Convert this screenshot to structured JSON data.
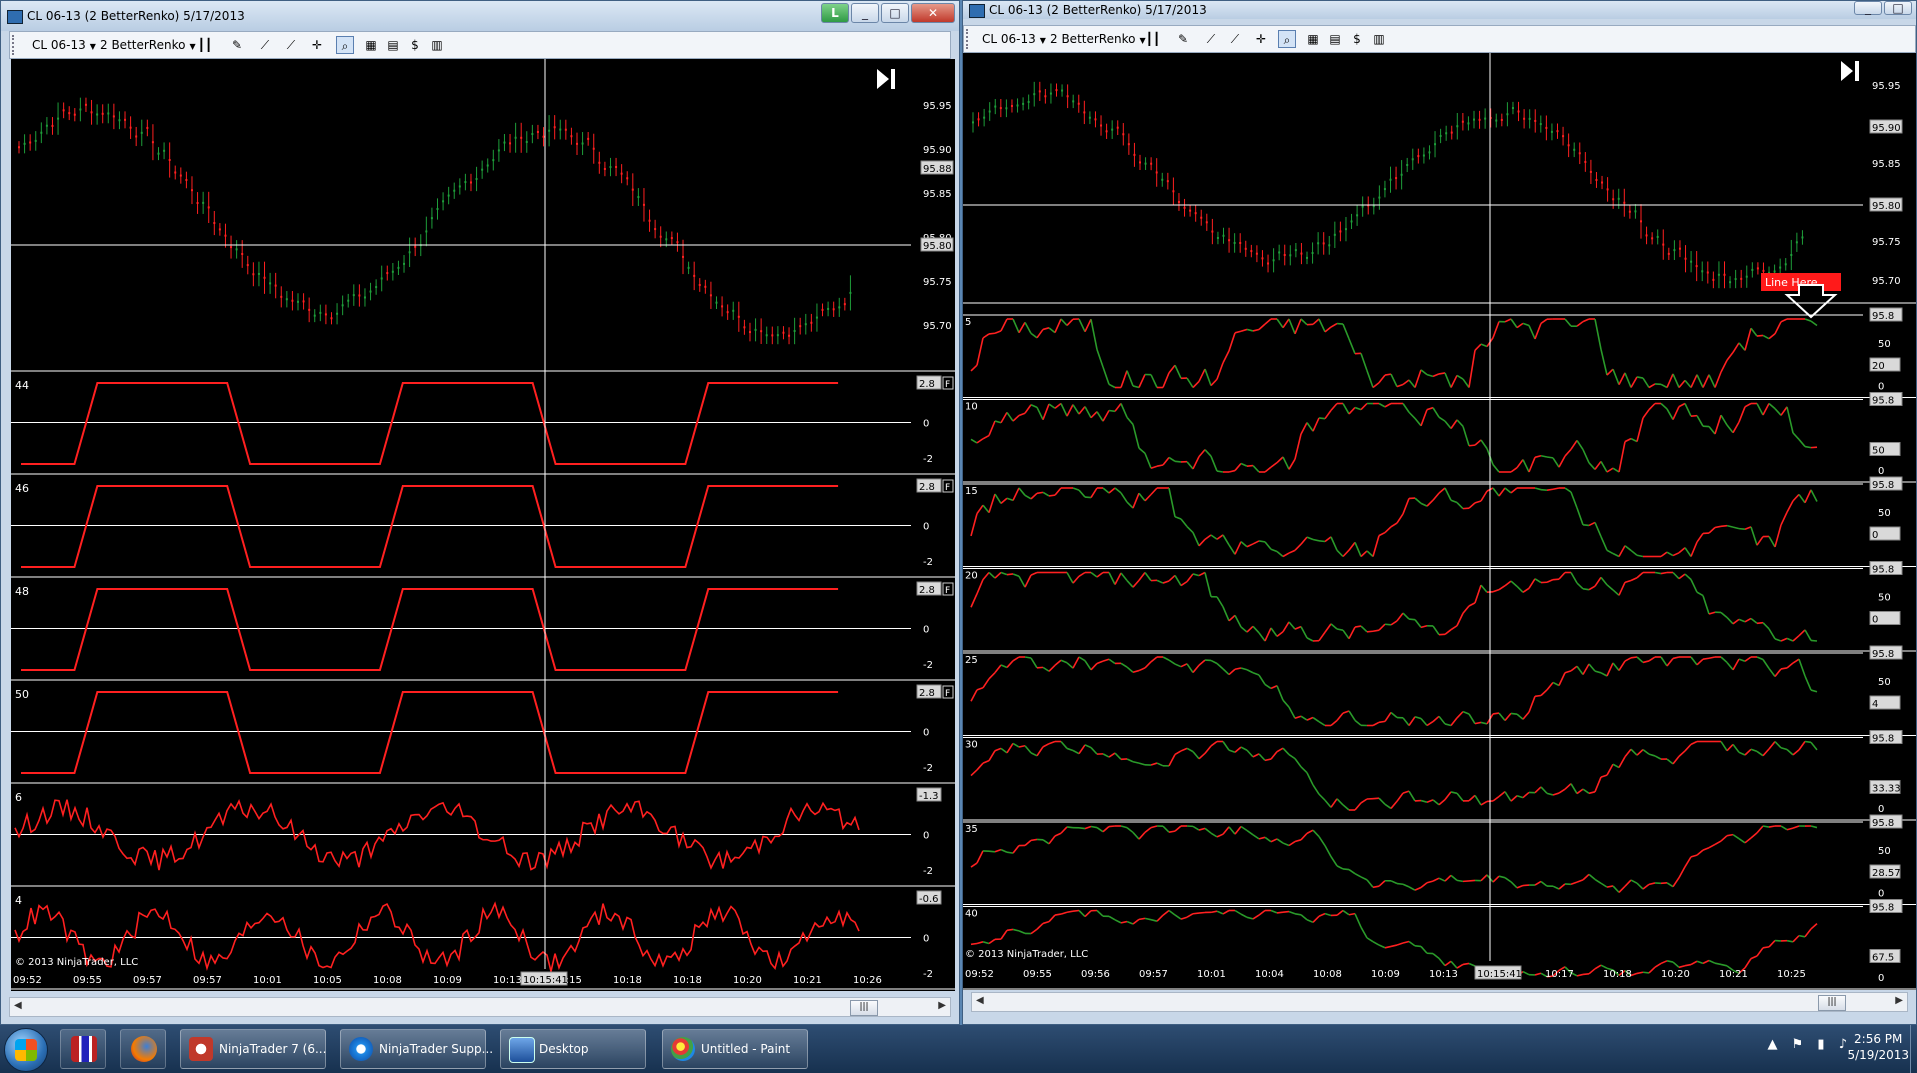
{
  "colors": {
    "up_bar": "#1e9e3a",
    "down_bar": "#ff2020",
    "osc_red": "#ff2020",
    "osc_green": "#2a9a2a",
    "chart_bg": "#000000",
    "grid": "#ffffff",
    "label_box": "#d9d9d9"
  },
  "windows": {
    "left": {
      "title": "CL 06-13 (2 BetterRenko)  5/17/2013",
      "instrument": "CL 06-13",
      "bar_type": "2 BetterRenko",
      "link_button": "L",
      "copyright": "© 2013 NinjaTrader, LLC",
      "crosshair_time": "10:15:41",
      "price_axis": [
        "95.95",
        "95.90",
        "95.85",
        "95.80",
        "95.75",
        "95.70"
      ],
      "current_price": "95.88",
      "crosshair_price": "95.80",
      "time_axis": [
        "09:52",
        "09:55",
        "09:57",
        "09:57",
        "10:01",
        "10:05",
        "10:08",
        "10:09",
        "10:13",
        "10:15",
        "10:18",
        "10:18",
        "10:20",
        "10:21",
        "10:26"
      ],
      "panels": [
        {
          "label": "44",
          "ticks": [
            "2",
            "0",
            "-2"
          ],
          "value": "2.8",
          "flag": "F"
        },
        {
          "label": "46",
          "ticks": [
            "2",
            "0",
            "-2"
          ],
          "value": "2.8",
          "flag": "F"
        },
        {
          "label": "48",
          "ticks": [
            "2",
            "0",
            "-2"
          ],
          "value": "2.8",
          "flag": "F"
        },
        {
          "label": "50",
          "ticks": [
            "2",
            "0",
            "-2"
          ],
          "value": "2.8",
          "flag": "F"
        },
        {
          "label": "6",
          "ticks": [
            "2",
            "0",
            "-2"
          ],
          "value": "-1.3",
          "flag": ""
        },
        {
          "label": "4",
          "ticks": [
            "2",
            "0",
            "-2"
          ],
          "value": "-0.6",
          "flag": ""
        }
      ]
    },
    "right": {
      "title": "CL 06-13 (2 BetterRenko)  5/17/2013",
      "instrument": "CL 06-13",
      "bar_type": "2 BetterRenko",
      "copyright": "© 2013 NinjaTrader, LLC",
      "crosshair_time": "10:15:41",
      "price_axis": [
        "95.95",
        "95.90",
        "95.85",
        "95.80",
        "95.75",
        "95.70"
      ],
      "current_price": "95.90",
      "crosshair_price": "95.80",
      "annotation": "Line Here",
      "time_axis": [
        "09:52",
        "09:55",
        "09:56",
        "09:57",
        "10:01",
        "10:04",
        "10:08",
        "10:09",
        "10:13",
        "10:15",
        "10:17",
        "10:18",
        "10:20",
        "10:21",
        "10:25"
      ],
      "panels": [
        {
          "label": "5",
          "ticks": [
            "50",
            "0"
          ],
          "marker": "95.8",
          "value": "20"
        },
        {
          "label": "10",
          "ticks": [
            "0"
          ],
          "marker": "95.8",
          "value": "50"
        },
        {
          "label": "15",
          "ticks": [
            "50"
          ],
          "marker": "95.8",
          "value": "0"
        },
        {
          "label": "20",
          "ticks": [
            "50"
          ],
          "marker": "95.8",
          "value": "0"
        },
        {
          "label": "25",
          "ticks": [
            "50"
          ],
          "marker": "95.8",
          "value": "4"
        },
        {
          "label": "30",
          "ticks": [
            "0"
          ],
          "marker": "95.8",
          "value": "33.33"
        },
        {
          "label": "35",
          "ticks": [
            "50",
            "0"
          ],
          "marker": "95.8",
          "value": "28.57"
        },
        {
          "label": "40",
          "ticks": [
            "0"
          ],
          "marker": "95.8",
          "value": "67.5"
        }
      ]
    }
  },
  "taskbar": {
    "items": [
      {
        "label": "NinjaTrader 7 (6..."
      },
      {
        "label": "NinjaTrader Supp..."
      },
      {
        "label": "Desktop"
      },
      {
        "label": "Untitled - Paint"
      }
    ],
    "time": "2:56 PM",
    "date": "5/19/2013"
  }
}
